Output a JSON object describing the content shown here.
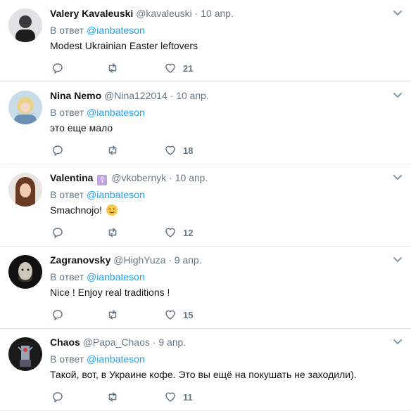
{
  "reply_prefix": "В ответ",
  "tweets": [
    {
      "name": "Valery Kavaleuski",
      "handle": "@kavaleuski",
      "dot": "·",
      "date": "10 апр.",
      "mention": "@ianbateson",
      "text": "Modest Ukrainian Easter leftovers",
      "likes": "21"
    },
    {
      "name": "Nina Nemo",
      "handle": "@Nina122014",
      "dot": "·",
      "date": "10 апр.",
      "mention": "@ianbateson",
      "text": "это еще мало",
      "likes": "18"
    },
    {
      "name": "Valentina",
      "badge": "☦",
      "handle": "@vkobernyk",
      "dot": "·",
      "date": "10 апр.",
      "mention": "@ianbateson",
      "text": "Smachnojo!",
      "likes": "12"
    },
    {
      "name": "Zagranovsky",
      "handle": "@HighYuza",
      "dot": "·",
      "date": "9 апр.",
      "mention": "@ianbateson",
      "text": "Nice ! Enjoy real traditions !",
      "likes": "15"
    },
    {
      "name": "Chaos",
      "handle": "@Papa_Chaos",
      "dot": "·",
      "date": "9 апр.",
      "mention": "@ianbateson",
      "text": "Такой, вот, в Украине кофе. Это вы ещё на покушать не заходили).",
      "likes": "11"
    }
  ],
  "colors": {
    "accent": "#1da1f2",
    "muted": "#657786",
    "text": "#14171a",
    "divider": "#e6ecf0"
  }
}
